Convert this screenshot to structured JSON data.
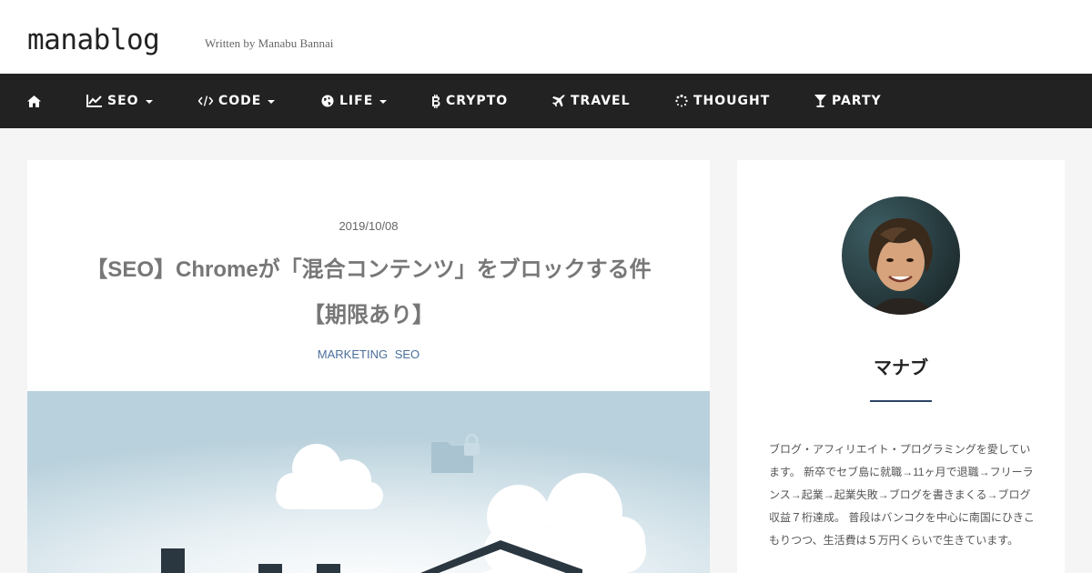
{
  "header": {
    "logo": "manablog",
    "tagline": "Written by Manabu Bannai"
  },
  "nav": {
    "items": [
      {
        "label": "",
        "icon": "home-icon"
      },
      {
        "label": "SEO",
        "icon": "line-chart-icon",
        "dropdown": true
      },
      {
        "label": "CODE",
        "icon": "code-icon",
        "dropdown": true
      },
      {
        "label": "LIFE",
        "icon": "globe-icon",
        "dropdown": true
      },
      {
        "label": "CRYPTO",
        "icon": "bitcoin-icon",
        "dropdown": false
      },
      {
        "label": "TRAVEL",
        "icon": "plane-icon",
        "dropdown": false
      },
      {
        "label": "THOUGHT",
        "icon": "spinner-icon",
        "dropdown": false
      },
      {
        "label": "PARTY",
        "icon": "cocktail-icon",
        "dropdown": false
      }
    ]
  },
  "article": {
    "date": "2019/10/08",
    "title_line1": "【SEO】Chromeが「混合コンテンツ」をブロックする件",
    "title_line2": "【期限あり】",
    "categories": [
      "MARKETING",
      "SEO"
    ]
  },
  "sidebar": {
    "author_name": "マナブ",
    "bio": "ブログ・アフィリエイト・プログラミングを愛しています。 新卒でセブ島に就職→11ヶ月で退職→フリーランス→起業→起業失敗→ブログを書きまくる→ブログ収益７桁達成。 普段はバンコクを中心に南国にひきこもりつつ、生活費は５万円くらいで生きています。"
  },
  "colors": {
    "nav_bg": "#222222",
    "accent": "#2c4466",
    "category_link": "#4a6f9a",
    "hero_sky": "#b8d0dc"
  }
}
